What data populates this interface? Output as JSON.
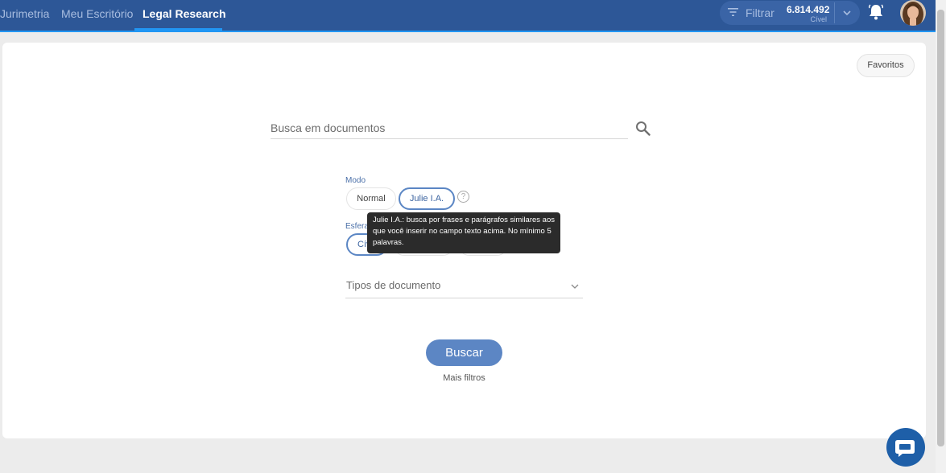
{
  "nav": {
    "items": [
      {
        "label": "Jurimetria"
      },
      {
        "label": "Meu Escritório"
      },
      {
        "label": "Legal Research"
      }
    ],
    "filter_label": "Filtrar",
    "count_value": "6.814.492",
    "count_sub": "Cível"
  },
  "favorites_label": "Favoritos",
  "search": {
    "placeholder": "Busca em documentos"
  },
  "mode": {
    "label": "Modo",
    "options": [
      {
        "label": "Normal"
      },
      {
        "label": "Julie I.A."
      }
    ],
    "help_symbol": "?"
  },
  "sphere": {
    "label": "Esfera",
    "options": [
      {
        "label": "Cível"
      }
    ]
  },
  "tooltip": {
    "text": "Julie I.A.: busca por frases e parágrafos similares aos que você inserir no campo texto acima. No mínimo 5 palavras."
  },
  "document_types": {
    "label": "Tipos de documento"
  },
  "buscar_label": "Buscar",
  "more_filters_label": "Mais filtros",
  "icons": [
    "filter-icon",
    "chevron-down-icon",
    "bell-icon",
    "avatar",
    "search-icon",
    "help-icon",
    "chat-icon"
  ],
  "colors": {
    "topbar": "#2d5797",
    "accent": "#2196f3",
    "primary_button": "#5c86c4",
    "tooltip_bg": "#2b2b2b"
  }
}
